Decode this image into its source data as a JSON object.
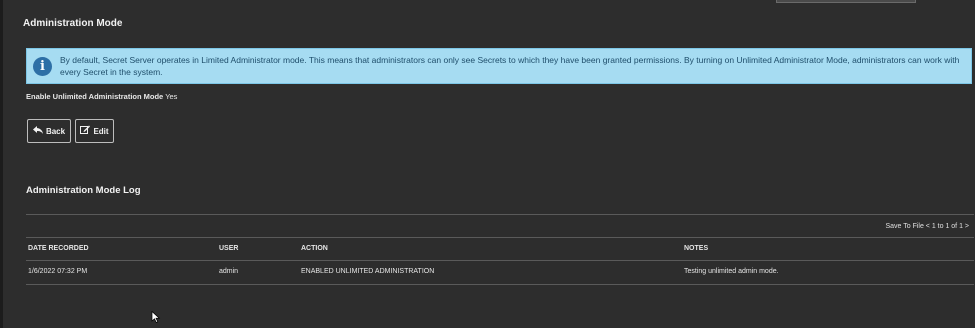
{
  "page": {
    "title": "Administration Mode"
  },
  "info": {
    "icon": "info-circle-icon",
    "text": "By default, Secret Server operates in Limited Administrator mode. This means that administrators can only see Secrets to which they have been granted permissions. By turning on Unlimited Administrator Mode, administrators can work with every Secret in the system."
  },
  "setting": {
    "label": "Enable Unlimited Administration Mode",
    "value": "Yes"
  },
  "buttons": {
    "back": {
      "label": "Back",
      "icon": "back-arrow-icon"
    },
    "edit": {
      "label": "Edit",
      "icon": "edit-icon"
    }
  },
  "log": {
    "title": "Administration Mode Log",
    "pager": "Save To File < 1 to 1 of 1 >",
    "columns": [
      "DATE RECORDED",
      "USER",
      "ACTION",
      "NOTES"
    ],
    "rows": [
      {
        "date": "1/6/2022 07:32 PM",
        "user": "admin",
        "action": "ENABLED UNLIMITED ADMINISTRATION",
        "notes": "Testing unlimited admin mode."
      }
    ]
  },
  "colors": {
    "background": "#2d2d2d",
    "info_bg": "#a6dcf2",
    "info_text": "#1f4e6b",
    "info_icon": "#2d6fa6"
  }
}
